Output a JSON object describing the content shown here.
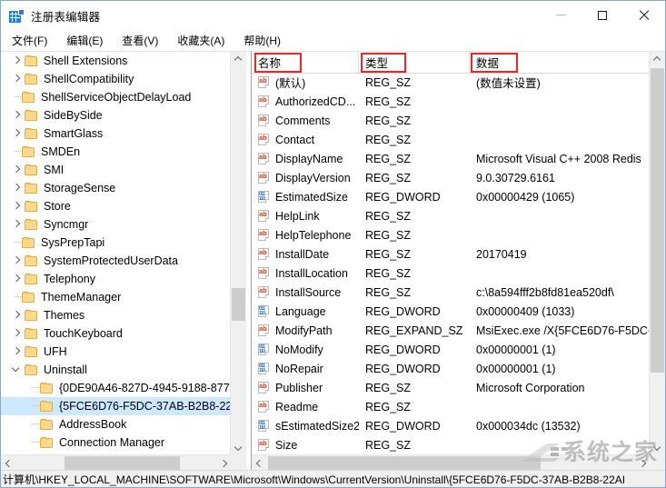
{
  "window": {
    "title": "注册表编辑器",
    "icon": "registry-icon",
    "minimize_label": "—",
    "maximize_label": "□",
    "close_label": "✕"
  },
  "menu": {
    "items": [
      {
        "label": "文件(F)",
        "name": "menu-file"
      },
      {
        "label": "编辑(E)",
        "name": "menu-edit"
      },
      {
        "label": "查看(V)",
        "name": "menu-view"
      },
      {
        "label": "收藏夹(A)",
        "name": "menu-favorites"
      },
      {
        "label": "帮助(H)",
        "name": "menu-help"
      }
    ]
  },
  "tree": {
    "items": [
      {
        "label": "Shell Extensions",
        "twisty": "collapsed",
        "selected": false
      },
      {
        "label": "ShellCompatibility",
        "twisty": "collapsed",
        "selected": false
      },
      {
        "label": "ShellServiceObjectDelayLoad",
        "twisty": "leaf",
        "selected": false
      },
      {
        "label": "SideBySide",
        "twisty": "collapsed",
        "selected": false
      },
      {
        "label": "SmartGlass",
        "twisty": "collapsed",
        "selected": false
      },
      {
        "label": "SMDEn",
        "twisty": "leaf",
        "selected": false
      },
      {
        "label": "SMI",
        "twisty": "collapsed",
        "selected": false
      },
      {
        "label": "StorageSense",
        "twisty": "collapsed",
        "selected": false
      },
      {
        "label": "Store",
        "twisty": "collapsed",
        "selected": false
      },
      {
        "label": "Syncmgr",
        "twisty": "collapsed",
        "selected": false
      },
      {
        "label": "SysPrepTapi",
        "twisty": "leaf",
        "selected": false
      },
      {
        "label": "SystemProtectedUserData",
        "twisty": "collapsed",
        "selected": false
      },
      {
        "label": "Telephony",
        "twisty": "collapsed",
        "selected": false
      },
      {
        "label": "ThemeManager",
        "twisty": "leaf",
        "selected": false
      },
      {
        "label": "Themes",
        "twisty": "collapsed",
        "selected": false
      },
      {
        "label": "TouchKeyboard",
        "twisty": "collapsed",
        "selected": false
      },
      {
        "label": "UFH",
        "twisty": "collapsed",
        "selected": false
      },
      {
        "label": "Uninstall",
        "twisty": "expanded",
        "selected": false
      },
      {
        "label": "{0DE90A46-827D-4945-9188-877",
        "twisty": "leaf",
        "selected": false,
        "child": true
      },
      {
        "label": "{5FCE6D76-F5DC-37AB-B2B8-22",
        "twisty": "leaf",
        "selected": true,
        "child": true
      },
      {
        "label": "AddressBook",
        "twisty": "leaf",
        "selected": false,
        "child": true
      },
      {
        "label": "Connection Manager",
        "twisty": "leaf",
        "selected": false,
        "child": true
      }
    ]
  },
  "list": {
    "columns": [
      {
        "label": "名称",
        "name": "column-name",
        "highlighted": true
      },
      {
        "label": "类型",
        "name": "column-type",
        "highlighted": true
      },
      {
        "label": "数据",
        "name": "column-data",
        "highlighted": true
      }
    ],
    "rows": [
      {
        "name": "(默认)",
        "icon": "string-value-icon",
        "type": "REG_SZ",
        "data": "(数值未设置)"
      },
      {
        "name": "AuthorizedCD...",
        "icon": "string-value-icon",
        "type": "REG_SZ",
        "data": ""
      },
      {
        "name": "Comments",
        "icon": "string-value-icon",
        "type": "REG_SZ",
        "data": ""
      },
      {
        "name": "Contact",
        "icon": "string-value-icon",
        "type": "REG_SZ",
        "data": ""
      },
      {
        "name": "DisplayName",
        "icon": "string-value-icon",
        "type": "REG_SZ",
        "data": "Microsoft Visual C++ 2008 Redis"
      },
      {
        "name": "DisplayVersion",
        "icon": "string-value-icon",
        "type": "REG_SZ",
        "data": "9.0.30729.6161"
      },
      {
        "name": "EstimatedSize",
        "icon": "dword-value-icon",
        "type": "REG_DWORD",
        "data": "0x00000429 (1065)"
      },
      {
        "name": "HelpLink",
        "icon": "string-value-icon",
        "type": "REG_SZ",
        "data": ""
      },
      {
        "name": "HelpTelephone",
        "icon": "string-value-icon",
        "type": "REG_SZ",
        "data": ""
      },
      {
        "name": "InstallDate",
        "icon": "string-value-icon",
        "type": "REG_SZ",
        "data": "20170419"
      },
      {
        "name": "InstallLocation",
        "icon": "string-value-icon",
        "type": "REG_SZ",
        "data": ""
      },
      {
        "name": "InstallSource",
        "icon": "string-value-icon",
        "type": "REG_SZ",
        "data": "c:\\8a594fff2b8fd81ea520df\\"
      },
      {
        "name": "Language",
        "icon": "dword-value-icon",
        "type": "REG_DWORD",
        "data": "0x00000409 (1033)"
      },
      {
        "name": "ModifyPath",
        "icon": "string-value-icon",
        "type": "REG_EXPAND_SZ",
        "data": "MsiExec.exe /X{5FCE6D76-F5DC-"
      },
      {
        "name": "NoModify",
        "icon": "dword-value-icon",
        "type": "REG_DWORD",
        "data": "0x00000001 (1)"
      },
      {
        "name": "NoRepair",
        "icon": "dword-value-icon",
        "type": "REG_DWORD",
        "data": "0x00000001 (1)"
      },
      {
        "name": "Publisher",
        "icon": "string-value-icon",
        "type": "REG_SZ",
        "data": "Microsoft Corporation"
      },
      {
        "name": "Readme",
        "icon": "string-value-icon",
        "type": "REG_SZ",
        "data": ""
      },
      {
        "name": "sEstimatedSize2",
        "icon": "dword-value-icon",
        "type": "REG_DWORD",
        "data": "0x000034dc (13532)"
      },
      {
        "name": "Size",
        "icon": "string-value-icon",
        "type": "REG_SZ",
        "data": ""
      }
    ]
  },
  "statusbar": {
    "path": "计算机\\HKEY_LOCAL_MACHINE\\SOFTWARE\\Microsoft\\Windows\\CurrentVersion\\Uninstall\\{5FCE6D76-F5DC-37AB-B2B8-22AI"
  },
  "watermark": {
    "text": "系统之家"
  },
  "colors": {
    "selection": "#cde8ff",
    "annotation": "#e8262b",
    "folder": "#ffd98b",
    "titlebar": "#ffffff",
    "scrollbar_thumb": "#cdcdcd"
  }
}
